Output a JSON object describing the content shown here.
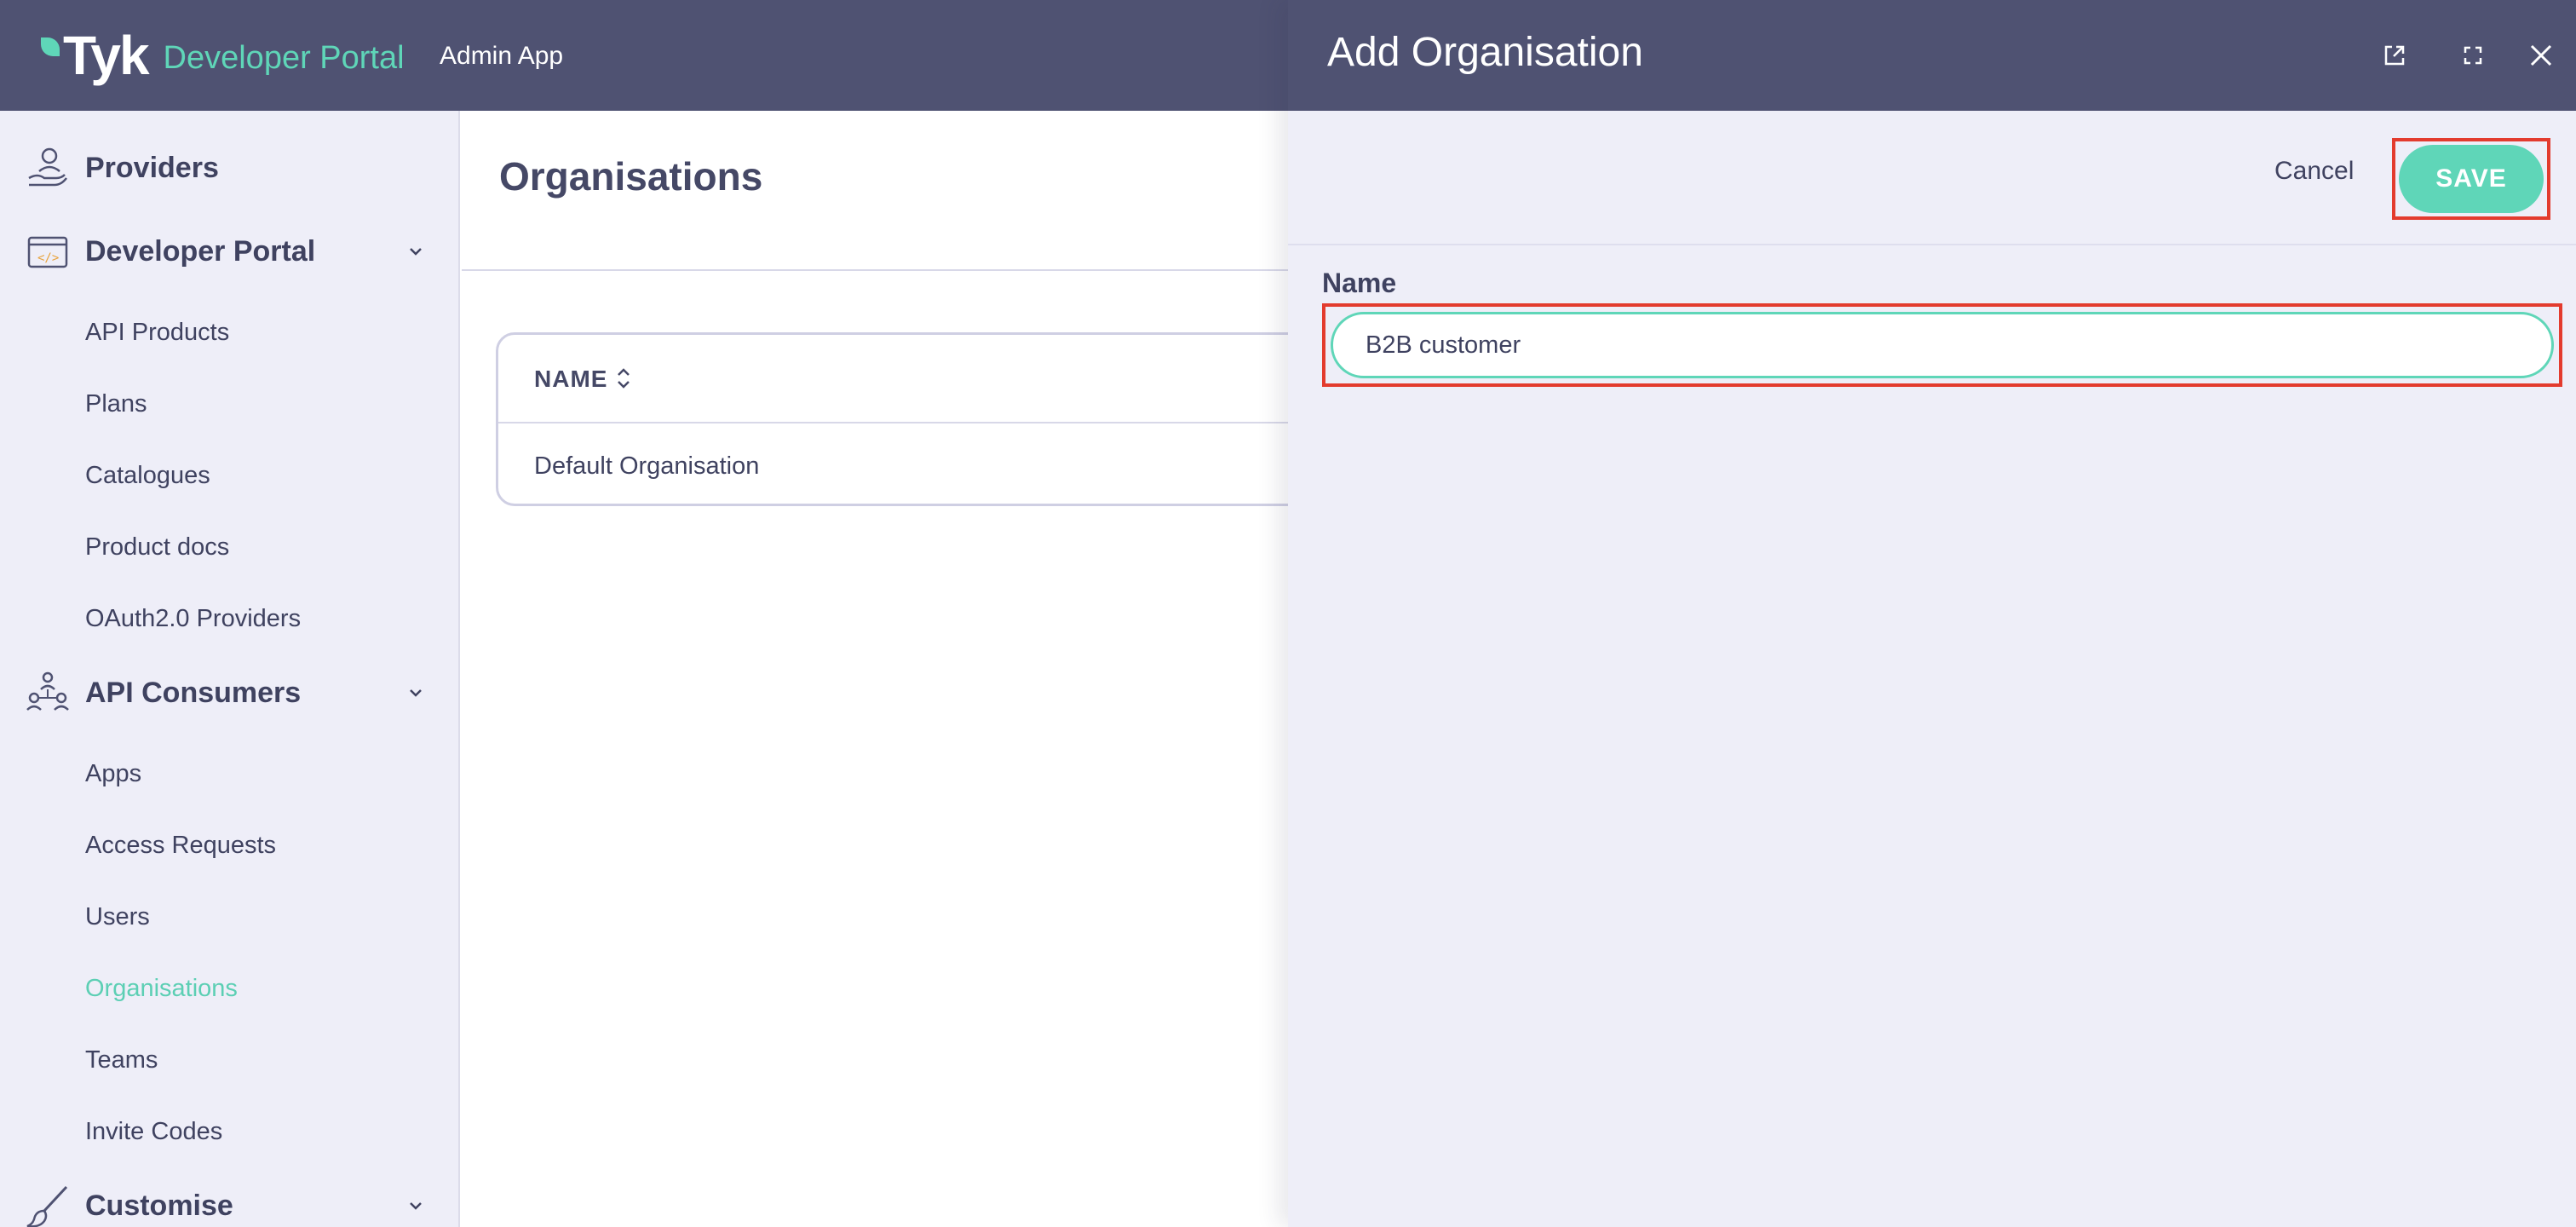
{
  "header": {
    "logo_text": "Tyk",
    "portal_text": "Developer Portal",
    "app_name": "Admin App"
  },
  "sidebar": {
    "sections": [
      {
        "label": "Providers",
        "icon": "provider-hand-icon",
        "expandable": false
      },
      {
        "label": "Developer Portal",
        "icon": "portal-code-icon",
        "expandable": true,
        "items": [
          "API Products",
          "Plans",
          "Catalogues",
          "Product docs",
          "OAuth2.0 Providers"
        ]
      },
      {
        "label": "API Consumers",
        "icon": "consumers-group-icon",
        "expandable": true,
        "items": [
          "Apps",
          "Access Requests",
          "Users",
          "Organisations",
          "Teams",
          "Invite Codes"
        ]
      },
      {
        "label": "Customise",
        "icon": "brush-icon",
        "expandable": true
      }
    ],
    "active_item": "Organisations"
  },
  "main": {
    "title": "Organisations",
    "table": {
      "columns": [
        "NAME"
      ],
      "rows": [
        [
          "Default Organisation"
        ]
      ]
    }
  },
  "drawer": {
    "title": "Add Organisation",
    "icons": [
      "external-link-icon",
      "fullscreen-icon",
      "close-icon"
    ],
    "cancel_label": "Cancel",
    "save_label": "SAVE",
    "field_label": "Name",
    "field_value": "B2B customer"
  },
  "colors": {
    "header_bg": "#4f5272",
    "accent": "#5fd6b8",
    "sidebar_bg": "#eeeef8",
    "highlight": "#e33b2e",
    "text": "#3f4260"
  }
}
